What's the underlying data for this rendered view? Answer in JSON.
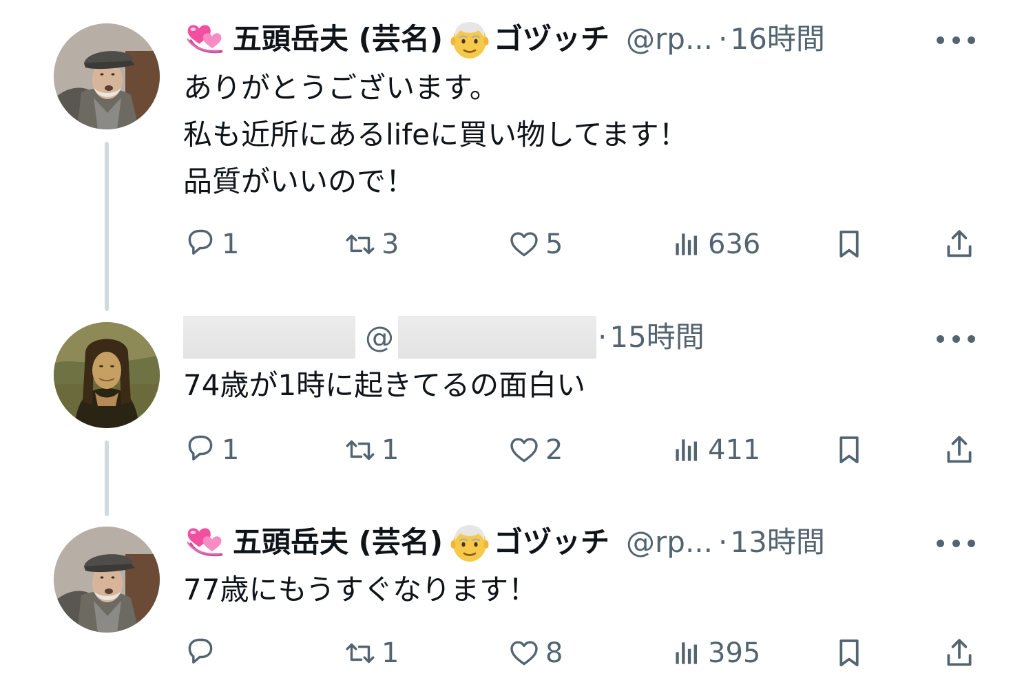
{
  "thread": [
    {
      "author_name": "五頭岳夫 (芸名)",
      "author_suffix": "ゴヅッチ",
      "handle": "@rp...",
      "separator": "·",
      "time": "16時間",
      "avatar": "elderly-man-in-flat-cap",
      "name_emojis": [
        "heart-emoji",
        "old-man-emoji"
      ],
      "lines": [
        "ありがとうございます。",
        "私も近所にあるlifeに買い物してます！",
        "品質がいいので！"
      ],
      "reply_count": "1",
      "repost_count": "3",
      "like_count": "5",
      "view_count": "636"
    },
    {
      "author_name": "",
      "handle": "@",
      "separator": "·",
      "time": "15時間",
      "avatar": "mona-lisa",
      "name_redacted": true,
      "lines": [
        "74歳が1時に起きてるの面白い"
      ],
      "reply_count": "1",
      "repost_count": "1",
      "like_count": "2",
      "view_count": "411"
    },
    {
      "author_name": "五頭岳夫 (芸名)",
      "author_suffix": "ゴヅッチ",
      "handle": "@rp...",
      "separator": "·",
      "time": "13時間",
      "avatar": "elderly-man-in-flat-cap",
      "name_emojis": [
        "heart-emoji",
        "old-man-emoji"
      ],
      "lines": [
        "77歳にもうすぐなります！"
      ],
      "reply_count": "",
      "repost_count": "1",
      "like_count": "8",
      "view_count": "395"
    }
  ],
  "colors": {
    "text": "#0f1419",
    "secondary": "#536471",
    "thread_line": "#cfd9de",
    "background": "#ffffff"
  },
  "icons": [
    "reply-icon",
    "repost-icon",
    "like-icon",
    "views-icon",
    "bookmark-icon",
    "share-icon",
    "more-icon"
  ]
}
